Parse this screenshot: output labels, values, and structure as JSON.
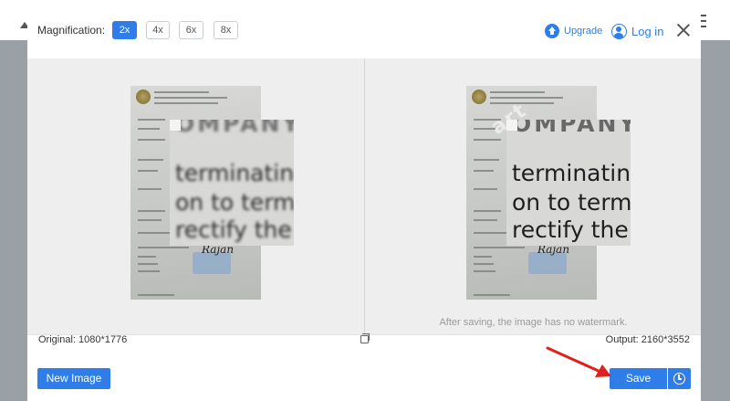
{
  "modal": {
    "magnification_label": "Magnification:",
    "magnifications": [
      {
        "label": "2x",
        "selected": true
      },
      {
        "label": "4x",
        "selected": false
      },
      {
        "label": "6x",
        "selected": false
      },
      {
        "label": "8x",
        "selected": false
      }
    ],
    "upgrade_label": "Upgrade",
    "login_label": "Log in"
  },
  "preview": {
    "zoom_text_lines": [
      "terminating",
      "on to termi",
      "rectify the"
    ],
    "zoom_text_top": "OMPANY",
    "watermark_text": "art",
    "signature": "Rajan",
    "no_watermark_note": "After saving, the image has no watermark."
  },
  "footer": {
    "original_label": "Original: 1080*1776",
    "output_label": "Output: 2160*3552",
    "new_image_label": "New Image",
    "save_label": "Save"
  },
  "colors": {
    "accent": "#2e7de8",
    "annotation_arrow": "#e0201c"
  },
  "icons": [
    "upgrade-icon",
    "user-icon",
    "close-icon",
    "copy-icon",
    "history-icon",
    "annotation-arrow-icon"
  ]
}
